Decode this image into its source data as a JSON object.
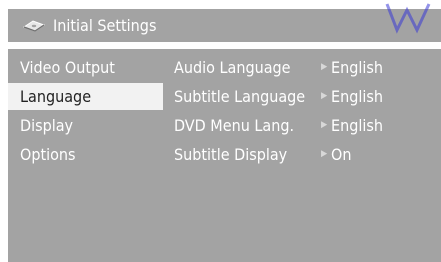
{
  "header": {
    "title": "Initial Settings",
    "icon": "disc-icon"
  },
  "sidebar": {
    "items": [
      {
        "label": "Video Output",
        "selected": false
      },
      {
        "label": "Language",
        "selected": true
      },
      {
        "label": "Display",
        "selected": false
      },
      {
        "label": "Options",
        "selected": false
      }
    ]
  },
  "main": {
    "rows": [
      {
        "label": "Audio Language",
        "value": "English"
      },
      {
        "label": "Subtitle Language",
        "value": "English"
      },
      {
        "label": "DVD Menu Lang.",
        "value": "English"
      },
      {
        "label": "Subtitle Display",
        "value": "On"
      }
    ]
  },
  "colors": {
    "panel": "#a3a3a3",
    "selected_bg": "#f2f2f2",
    "text": "#ffffff",
    "selected_text": "#222222",
    "accent": "#3b3bd6"
  }
}
